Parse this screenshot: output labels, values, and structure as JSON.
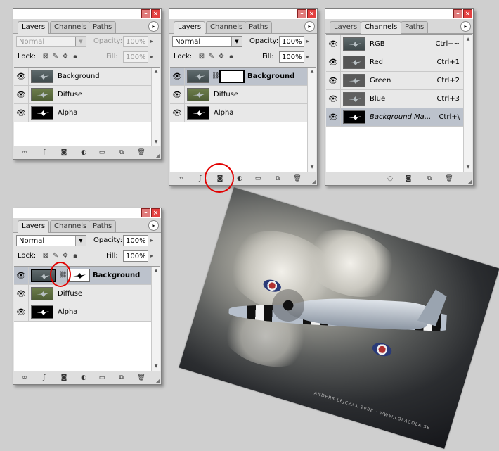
{
  "tabs": {
    "layers": "Layers",
    "channels": "Channels",
    "paths": "Paths"
  },
  "controls": {
    "blend_mode": "Normal",
    "opacity_label": "Opacity:",
    "opacity_value": "100%",
    "lock_label": "Lock:",
    "fill_label": "Fill:",
    "fill_value": "100%"
  },
  "panel_menu_glyph": "▸",
  "layers": {
    "background": "Background",
    "diffuse": "Diffuse",
    "alpha": "Alpha"
  },
  "channels": [
    {
      "name": "RGB",
      "shortcut": "Ctrl+~"
    },
    {
      "name": "Red",
      "shortcut": "Ctrl+1"
    },
    {
      "name": "Green",
      "shortcut": "Ctrl+2"
    },
    {
      "name": "Blue",
      "shortcut": "Ctrl+3"
    },
    {
      "name": "Background Ma...",
      "shortcut": "Ctrl+\\"
    }
  ],
  "photo": {
    "credit": "ANDERS LEJCZAK 2008 · WWW.LOLACOLA.SE"
  },
  "colors": {
    "highlight": "#e20000",
    "selected_row": "#bcc2cc"
  }
}
